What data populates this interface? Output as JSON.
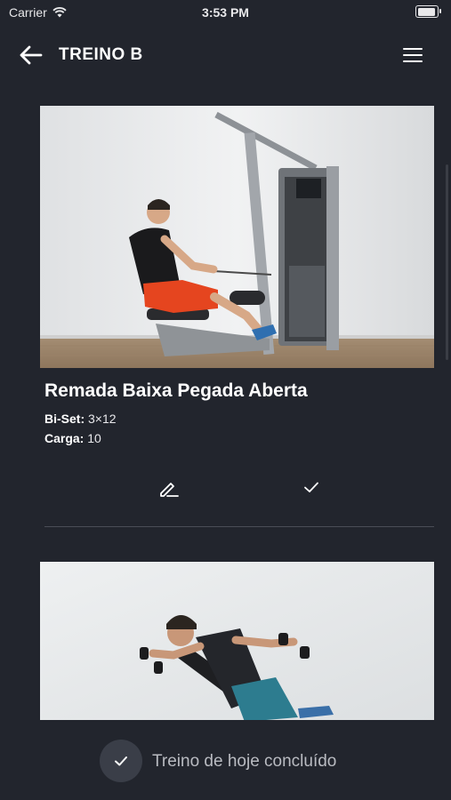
{
  "status_bar": {
    "carrier": "Carrier",
    "time": "3:53 PM"
  },
  "header": {
    "title": "TREINO B",
    "back_icon": "arrow-left-icon",
    "menu_icon": "hamburger-menu-icon"
  },
  "exercises": [
    {
      "name": "Remada Baixa Pegada Aberta",
      "details": [
        {
          "label": "Bi-Set:",
          "value": "3×12"
        },
        {
          "label": "Carga:",
          "value": "10"
        }
      ],
      "actions": [
        {
          "icon": "pencil-icon"
        },
        {
          "icon": "check-icon"
        }
      ]
    },
    {
      "name": "",
      "details": [],
      "actions": []
    }
  ],
  "footer": {
    "completed_label": "Treino de hoje concluído",
    "icon": "check-icon"
  },
  "colors": {
    "background": "#22252d",
    "divider": "#4a4d56",
    "done_circle": "#3a3e48"
  }
}
